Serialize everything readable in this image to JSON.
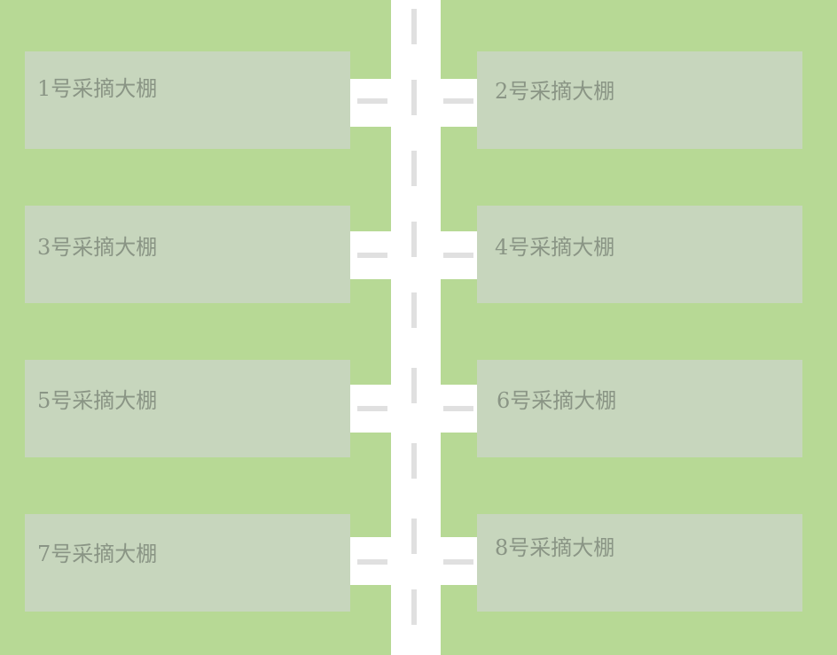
{
  "map": {
    "colors": {
      "ground": "#b7d995",
      "plot": "#c7d6bd",
      "road": "#ffffff",
      "road_marking": "#e0e0e0",
      "label": "#8a9585"
    },
    "plots": [
      {
        "label": "1号采摘大棚"
      },
      {
        "label": "2号采摘大棚"
      },
      {
        "label": "3号采摘大棚"
      },
      {
        "label": "4号采摘大棚"
      },
      {
        "label": "5号采摘大棚"
      },
      {
        "label": "6号采摘大棚"
      },
      {
        "label": "7号采摘大棚"
      },
      {
        "label": "8号采摘大棚"
      }
    ]
  }
}
